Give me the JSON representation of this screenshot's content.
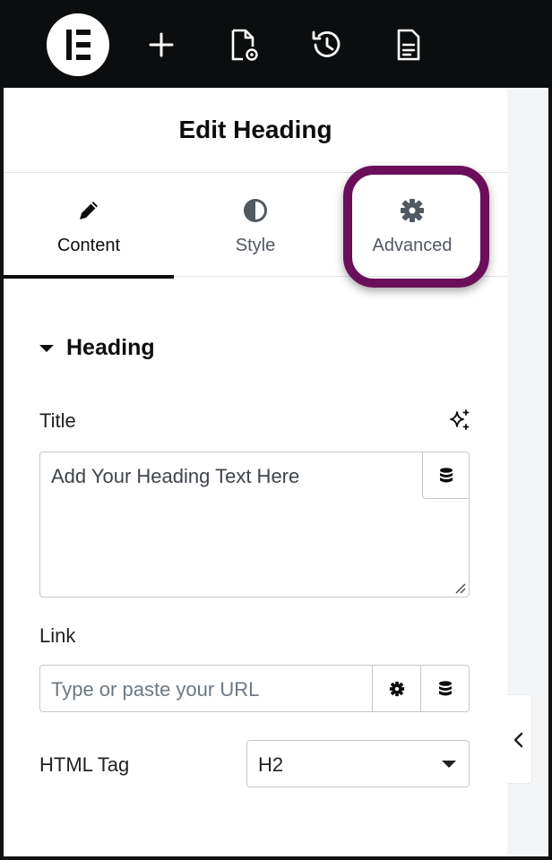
{
  "toolbar": {
    "icons": [
      "elementor-logo-icon",
      "plus-icon",
      "page-settings-icon",
      "history-icon",
      "document-icon"
    ]
  },
  "panel": {
    "title": "Edit Heading",
    "tabs": [
      {
        "label": "Content",
        "icon": "pencil-icon",
        "active": true
      },
      {
        "label": "Style",
        "icon": "half-circle-icon",
        "active": false
      },
      {
        "label": "Advanced",
        "icon": "gear-icon",
        "active": false
      }
    ],
    "highlight_color": "#6b0f5a"
  },
  "section": {
    "title": "Heading",
    "title_field": {
      "label": "Title",
      "placeholder": "Add Your Heading Text Here"
    },
    "link_field": {
      "label": "Link",
      "placeholder": "Type or paste your URL"
    },
    "html_tag": {
      "label": "HTML Tag",
      "value": "H2"
    }
  }
}
